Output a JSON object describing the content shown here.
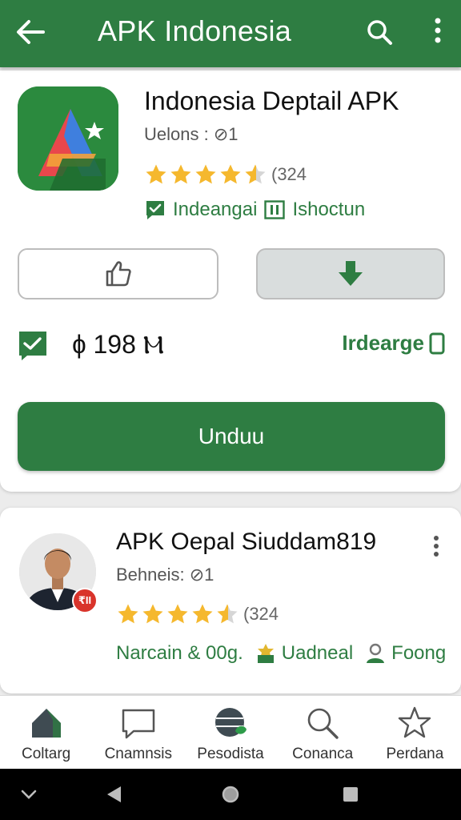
{
  "appbar": {
    "title": "APK Indonesia",
    "icons": {
      "back": "arrow-left-icon",
      "search": "search-icon",
      "more": "more-vert-icon"
    }
  },
  "app": {
    "name": "Indonesia Deptail APK",
    "version": "Uelons : ⊘1",
    "rating": {
      "stars": 4.5,
      "max": 5,
      "count_text": "(324"
    },
    "tags": [
      {
        "label": "Indeangai",
        "icon": "check-chat-icon"
      },
      {
        "label": "Ishoctun",
        "icon": "pause-box-icon"
      }
    ],
    "buttons": {
      "like_icon": "thumbs-up-icon",
      "download_icon": "download-arrow-icon",
      "main_label": "Unduu"
    },
    "size": "ɸ 198 Ⲙ",
    "install_label": "Irdearge"
  },
  "developer": {
    "name": "APK Oepal Siuddam819",
    "subtitle": "Behneis: ⊘1",
    "badge_text": "₹II",
    "rating": {
      "stars": 4.5,
      "max": 5,
      "count_text": "(324"
    },
    "meta": [
      {
        "label": "Narcain & 00g.",
        "icon": ""
      },
      {
        "label": "Uadneal",
        "icon": "award-icon"
      },
      {
        "label": "Foong",
        "icon": "person-icon"
      }
    ]
  },
  "bottom_nav": [
    {
      "label": "Coltarg",
      "icon": "home-icon"
    },
    {
      "label": "Cnamnsis",
      "icon": "chat-bubble-icon"
    },
    {
      "label": "Pesodista",
      "icon": "globe-icon"
    },
    {
      "label": "Conanca",
      "icon": "search-icon"
    },
    {
      "label": "Perdana",
      "icon": "star-icon"
    }
  ],
  "colors": {
    "primary": "#2e7d42",
    "star": "#f5b82e",
    "badge": "#d9342b",
    "system_bar": "#000000"
  }
}
